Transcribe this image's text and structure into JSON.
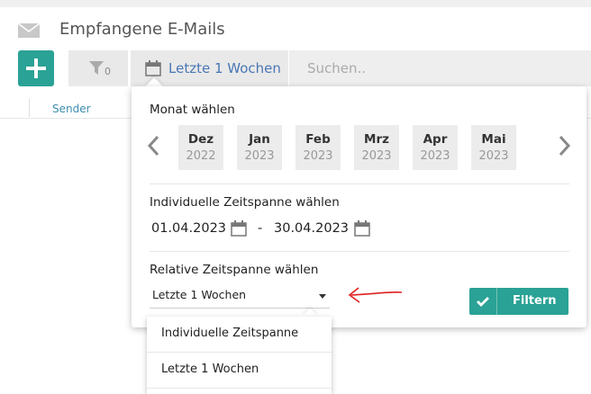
{
  "header": {
    "title": "Empfangene E-Mails"
  },
  "toolbar": {
    "filter_count": "0",
    "date_label": "Letzte 1 Wochen",
    "search_placeholder": "Suchen.."
  },
  "table": {
    "columns": [
      "Sender"
    ]
  },
  "popover": {
    "month_title": "Monat wählen",
    "months": [
      {
        "month": "Dez",
        "year": "2022"
      },
      {
        "month": "Jan",
        "year": "2023"
      },
      {
        "month": "Feb",
        "year": "2023"
      },
      {
        "month": "Mrz",
        "year": "2023"
      },
      {
        "month": "Apr",
        "year": "2023"
      },
      {
        "month": "Mai",
        "year": "2023"
      }
    ],
    "custom_title": "Individuelle Zeitspanne wählen",
    "from_date": "01.04.2023",
    "range_separator": "-",
    "to_date": "30.04.2023",
    "relative_title": "Relative Zeitspanne wählen",
    "relative_selected": "Letzte 1 Wochen",
    "filter_label": "Filtern"
  },
  "dropdown": {
    "options": [
      "Individuelle Zeitspanne",
      "Letzte 1 Wochen"
    ]
  },
  "colors": {
    "accent": "#2aa295",
    "link": "#4a77b4",
    "annotation": "#e02020"
  }
}
